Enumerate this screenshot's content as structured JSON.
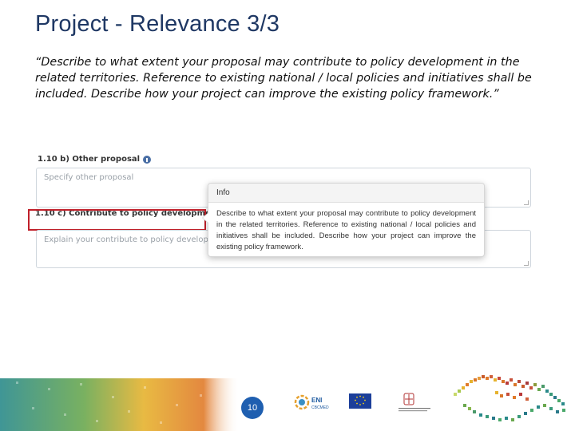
{
  "slide": {
    "title": "Project - Relevance 3/3",
    "quote": "“Describe to what extent your proposal may contribute to policy development in the related territories. Reference to existing national / local policies and initiatives shall be included. Describe how your project can improve the existing policy framework.”"
  },
  "form": {
    "field_b": {
      "label": "1.10 b) Other proposal",
      "placeholder": "Specify other proposal"
    },
    "field_c": {
      "label": "1.10 c) Contribute to policy development",
      "placeholder": "Explain your contribute to policy developme"
    },
    "highlight_color": "#c0202a"
  },
  "tooltip": {
    "title": "Info",
    "body": "Describe to what extent your proposal may contribute to policy development in the related territories. Reference to existing national / local policies and initiatives shall be included. Describe how your project can improve the existing policy framework."
  },
  "footer": {
    "page_number": "10",
    "logos": {
      "eni": "ENI CBCMED",
      "eu": "EUROPEAN UNION",
      "sardegna": "REGIONE AUTONOMA DELLA SARDEGNA"
    }
  },
  "colors": {
    "title": "#1f3864",
    "page_badge": "#1f5fb0",
    "info_icon_blue": "#4a6fa5",
    "info_icon_orange": "#b37a2a"
  }
}
